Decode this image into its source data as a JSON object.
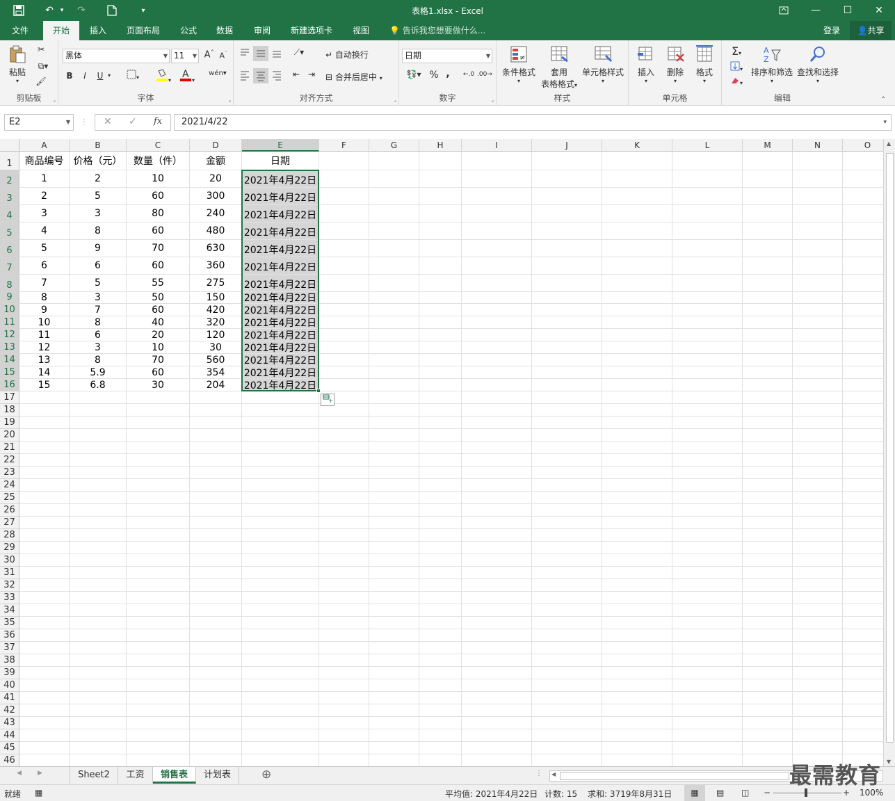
{
  "window": {
    "title": "表格1.xlsx - Excel",
    "minimize": "—",
    "maximize": "☐",
    "close": "✕",
    "restore": "⧉"
  },
  "quick_access": {
    "save": "💾",
    "undo": "↶",
    "redo": "↷",
    "new": "🗋",
    "more": "⌄"
  },
  "tabs": [
    {
      "label": "文件"
    },
    {
      "label": "开始"
    },
    {
      "label": "插入"
    },
    {
      "label": "页面布局"
    },
    {
      "label": "公式"
    },
    {
      "label": "数据"
    },
    {
      "label": "审阅"
    },
    {
      "label": "新建选项卡"
    },
    {
      "label": "视图"
    }
  ],
  "active_tab": "开始",
  "tell_me": "告诉我您想要做什么...",
  "login": "登录",
  "share": "共享",
  "ribbon": {
    "clipboard": {
      "label": "剪贴板",
      "paste": "粘贴"
    },
    "font": {
      "label": "字体",
      "font_name": "黑体",
      "font_size": "11",
      "bold": "B",
      "italic": "I",
      "underline": "U"
    },
    "alignment": {
      "label": "对齐方式",
      "wrap": "自动换行",
      "merge": "合并后居中"
    },
    "number": {
      "label": "数字",
      "format": "日期",
      "percent": "%",
      "comma": ","
    },
    "styles": {
      "label": "样式",
      "conditional": "条件格式",
      "table_format_1": "套用",
      "table_format_2": "表格格式",
      "cell_styles": "单元格样式"
    },
    "cells": {
      "label": "单元格",
      "insert": "插入",
      "delete": "删除",
      "format": "格式"
    },
    "editing": {
      "label": "编辑",
      "sort_filter": "排序和筛选",
      "find_select": "查找和选择"
    }
  },
  "formula_bar": {
    "name_box": "E2",
    "cancel": "✕",
    "enter": "✓",
    "fx": "fx",
    "value": "2021/4/22"
  },
  "columns": [
    "A",
    "B",
    "C",
    "D",
    "E",
    "F",
    "G",
    "H",
    "I",
    "J",
    "K",
    "L",
    "M",
    "N",
    "O"
  ],
  "selected_column": "E",
  "header_row": [
    "商品编号",
    "价格（元）",
    "数量（件）",
    "金额",
    "日期"
  ],
  "rows": [
    [
      "1",
      "2",
      "10",
      "20",
      "2021年4月22日"
    ],
    [
      "2",
      "5",
      "60",
      "300",
      "2021年4月22日"
    ],
    [
      "3",
      "3",
      "80",
      "240",
      "2021年4月22日"
    ],
    [
      "4",
      "8",
      "60",
      "480",
      "2021年4月22日"
    ],
    [
      "5",
      "9",
      "70",
      "630",
      "2021年4月22日"
    ],
    [
      "6",
      "6",
      "60",
      "360",
      "2021年4月22日"
    ],
    [
      "7",
      "5",
      "55",
      "275",
      "2021年4月22日"
    ],
    [
      "8",
      "3",
      "50",
      "150",
      "2021年4月22日"
    ],
    [
      "9",
      "7",
      "60",
      "420",
      "2021年4月22日"
    ],
    [
      "10",
      "8",
      "40",
      "320",
      "2021年4月22日"
    ],
    [
      "11",
      "6",
      "20",
      "120",
      "2021年4月22日"
    ],
    [
      "12",
      "3",
      "10",
      "30",
      "2021年4月22日"
    ],
    [
      "13",
      "8",
      "70",
      "560",
      "2021年4月22日"
    ],
    [
      "14",
      "5.9",
      "60",
      "354",
      "2021年4月22日"
    ],
    [
      "15",
      "6.8",
      "30",
      "204",
      "2021年4月22日"
    ]
  ],
  "row_numbers": [
    "1",
    "2",
    "3",
    "4",
    "5",
    "6",
    "7",
    "8",
    "9",
    "10",
    "11",
    "12",
    "13",
    "14",
    "15",
    "16",
    "17",
    "18",
    "19",
    "20",
    "21",
    "22",
    "23",
    "24",
    "25",
    "26",
    "27",
    "28",
    "29",
    "30",
    "31",
    "32",
    "33",
    "34",
    "35",
    "36",
    "37",
    "38",
    "39",
    "40",
    "41",
    "42",
    "43",
    "44",
    "45",
    "46"
  ],
  "sheets": [
    {
      "label": "Sheet2"
    },
    {
      "label": "工资"
    },
    {
      "label": "销售表"
    },
    {
      "label": "计划表"
    }
  ],
  "active_sheet": "销售表",
  "add_sheet": "⊕",
  "status": {
    "mode": "就绪",
    "average": "平均值: 2021年4月22日",
    "count": "计数: 15",
    "sum": "求和: 3719年8月31日",
    "zoom": "100%"
  },
  "watermark": "最需教育",
  "colors": {
    "accent": "#217346",
    "selection_fill": "#d6d6d6"
  }
}
